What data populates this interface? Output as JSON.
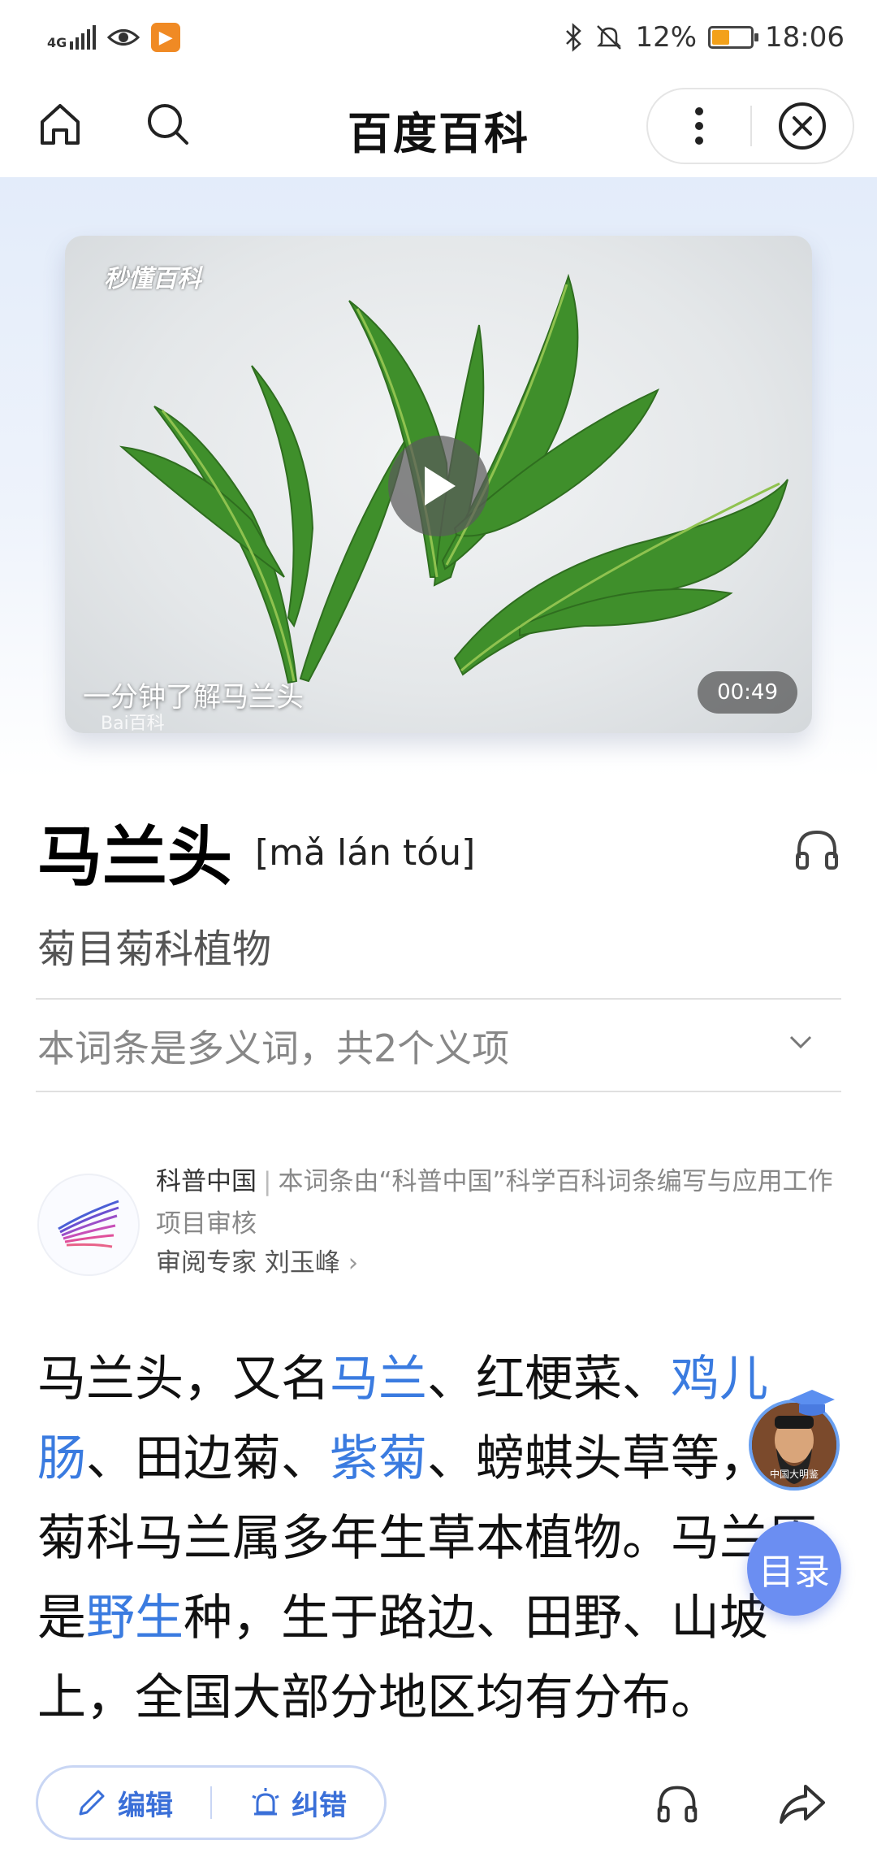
{
  "status_bar": {
    "network": "4G",
    "battery_percent": "12%",
    "battery_level": 0.12,
    "time": "18:06",
    "app_badge_icon": "video-app-icon"
  },
  "nav": {
    "title": "百度百科",
    "icons": [
      "home-icon",
      "search-icon",
      "more-icon",
      "close-icon"
    ]
  },
  "video": {
    "watermark_top": "秒懂百科",
    "caption": "一分钟了解马兰头",
    "watermark_bottom": "Bai百科",
    "duration": "00:49"
  },
  "entry": {
    "title": "马兰头",
    "pinyin": "[mǎ lán tóu]",
    "subtitle": "菊目菊科植物",
    "polysemy": "本词条是多义词，共2个义项"
  },
  "review": {
    "org": "科普中国",
    "separator": "|",
    "statement": "本词条由“科普中国”科学百科词条编写与应用工作项目审核",
    "expert_label": "审阅专家 刘玉峰",
    "expert_arrow": "›"
  },
  "body": {
    "t1": "马兰头，又名",
    "l1": "马兰",
    "t2": "、红梗菜、",
    "l2": "鸡儿肠",
    "t3": "、田边菊、",
    "l3": "紫菊",
    "t4": "、螃蜞头草等，为菊科马兰属多年生草本植物。马兰原是",
    "l4": "野生",
    "t5": "种，生于路边、田野、山坡上，全国大部分地区均有分布。"
  },
  "floating": {
    "toc_label": "目录",
    "avatar_text": "中国大明鉴"
  },
  "bottom_bar": {
    "edit_label": "编辑",
    "report_label": "纠错"
  },
  "colors": {
    "link": "#3a7be0",
    "toc_button": "#6b8ef2",
    "accent": "#3a6fd8"
  }
}
